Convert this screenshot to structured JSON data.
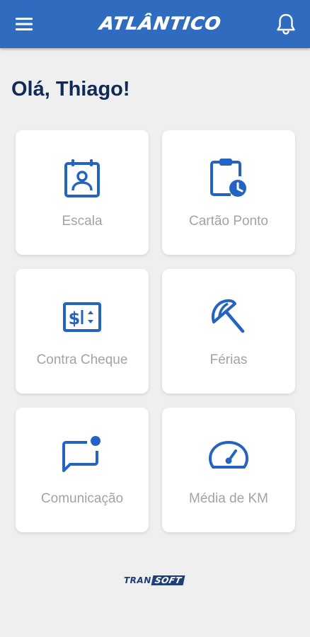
{
  "header": {
    "logo_text": "ATLÂNTICO",
    "menu_icon": "hamburger-menu-icon",
    "notification_icon": "bell-icon"
  },
  "greeting": "Olá, Thiago!",
  "cards": [
    {
      "label": "Escala",
      "icon": "id-badge-calendar-icon"
    },
    {
      "label": "Cartão Ponto",
      "icon": "clipboard-clock-icon"
    },
    {
      "label": "Contra Cheque",
      "icon": "paycheck-dollar-icon"
    },
    {
      "label": "Férias",
      "icon": "beach-umbrella-icon"
    },
    {
      "label": "Comunicação",
      "icon": "chat-notification-icon"
    },
    {
      "label": "Média de KM",
      "icon": "speedometer-icon"
    }
  ],
  "footer": {
    "brand_part1": "TRAN",
    "brand_part2": "SOFT"
  },
  "colors": {
    "primary": "#2f6bbf",
    "icon_blue": "#2563c2",
    "greeting": "#0f2a57",
    "card_label": "#a3a3a3",
    "background": "#efefef"
  }
}
